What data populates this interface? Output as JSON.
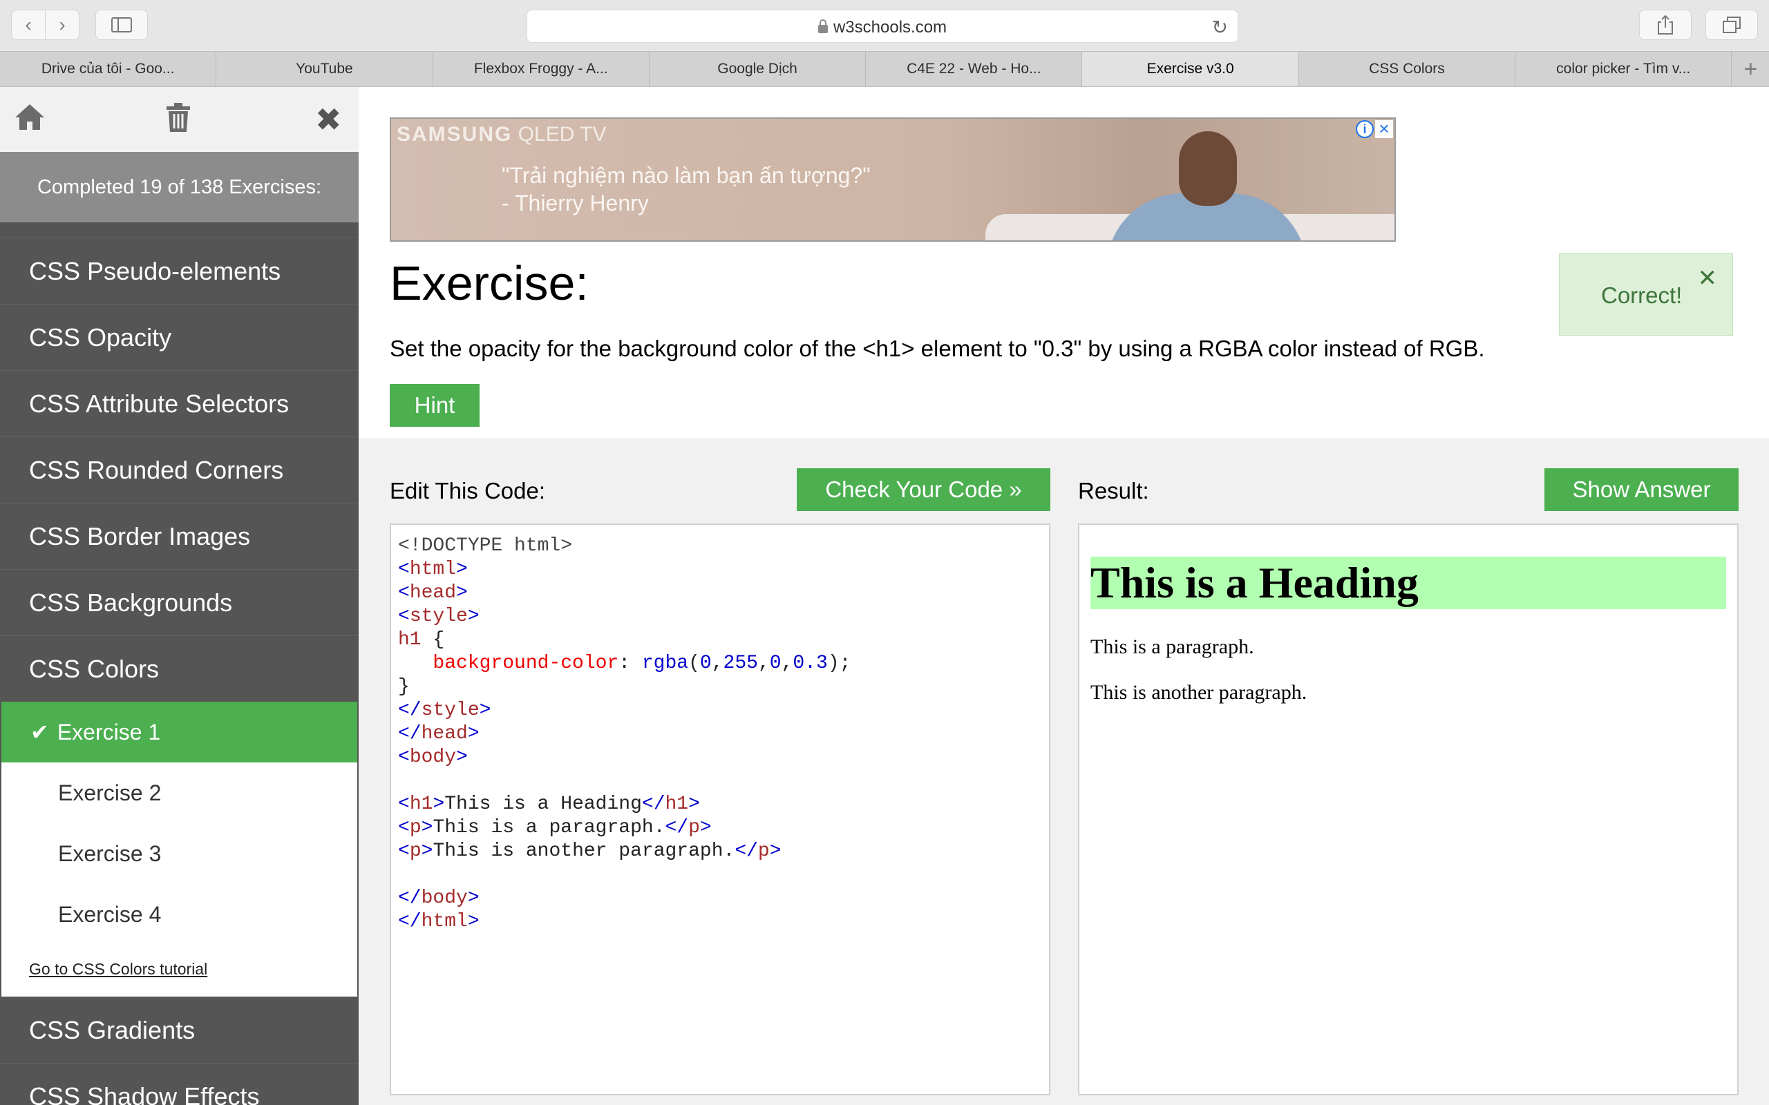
{
  "browser": {
    "address": "w3schools.com",
    "tabs": [
      {
        "label": "Drive của tôi - Goo...",
        "active": false
      },
      {
        "label": "YouTube",
        "active": false
      },
      {
        "label": "Flexbox Froggy - A...",
        "active": false
      },
      {
        "label": "Google Dịch",
        "active": false
      },
      {
        "label": "C4E 22 - Web - Ho...",
        "active": false
      },
      {
        "label": "Exercise v3.0",
        "active": true
      },
      {
        "label": "CSS Colors",
        "active": false
      },
      {
        "label": "color picker - Tìm v...",
        "active": false
      }
    ]
  },
  "sidebar": {
    "progress": "Completed 19 of 138 Exercises:",
    "sections_before": [
      "CSS Pseudo-elements",
      "CSS Opacity",
      "CSS Attribute Selectors",
      "CSS Rounded Corners",
      "CSS Border Images",
      "CSS Backgrounds",
      "CSS Colors"
    ],
    "exercises": [
      "Exercise 1",
      "Exercise 2",
      "Exercise 3",
      "Exercise 4"
    ],
    "active_exercise": "Exercise 1",
    "tutorial_link": "Go to CSS Colors tutorial",
    "sections_after": [
      "CSS Gradients",
      "CSS Shadow Effects"
    ]
  },
  "ad": {
    "brand_bold": "SAMSUNG",
    "brand_rest": " QLED TV",
    "quote_line1": "\"Trải nghiệm nào làm bạn ấn tượng?\"",
    "quote_line2": "- Thierry Henry"
  },
  "exercise": {
    "title": "Exercise:",
    "instructions": "Set the opacity for the background color of the <h1> element to \"0.3\" by using a RGBA color instead of RGB.",
    "hint_label": "Hint",
    "correct_text": "Correct!",
    "close_glyph": "✕"
  },
  "editor": {
    "edit_label": "Edit This Code:",
    "check_button": "Check Your Code »",
    "result_label": "Result:",
    "show_answer_button": "Show Answer",
    "code_lines": [
      [
        {
          "t": "doctype",
          "s": "<!DOCTYPE html>"
        }
      ],
      [
        {
          "t": "bracket",
          "s": "<"
        },
        {
          "t": "tag",
          "s": "html"
        },
        {
          "t": "bracket",
          "s": ">"
        }
      ],
      [
        {
          "t": "bracket",
          "s": "<"
        },
        {
          "t": "tag",
          "s": "head"
        },
        {
          "t": "bracket",
          "s": ">"
        }
      ],
      [
        {
          "t": "bracket",
          "s": "<"
        },
        {
          "t": "tag",
          "s": "style"
        },
        {
          "t": "bracket",
          "s": ">"
        }
      ],
      [
        {
          "t": "tag",
          "s": "h1"
        },
        {
          "t": "plain",
          "s": " {"
        }
      ],
      [
        {
          "t": "plain",
          "s": "   "
        },
        {
          "t": "prop",
          "s": "background-color"
        },
        {
          "t": "plain",
          "s": ": "
        },
        {
          "t": "val",
          "s": "rgba"
        },
        {
          "t": "plain",
          "s": "("
        },
        {
          "t": "val",
          "s": "0"
        },
        {
          "t": "plain",
          "s": ","
        },
        {
          "t": "val",
          "s": "255"
        },
        {
          "t": "plain",
          "s": ","
        },
        {
          "t": "val",
          "s": "0"
        },
        {
          "t": "plain",
          "s": ","
        },
        {
          "t": "val",
          "s": "0.3"
        },
        {
          "t": "plain",
          "s": ");"
        }
      ],
      [
        {
          "t": "plain",
          "s": "}"
        }
      ],
      [
        {
          "t": "bracket",
          "s": "</"
        },
        {
          "t": "tag",
          "s": "style"
        },
        {
          "t": "bracket",
          "s": ">"
        }
      ],
      [
        {
          "t": "bracket",
          "s": "</"
        },
        {
          "t": "tag",
          "s": "head"
        },
        {
          "t": "bracket",
          "s": ">"
        }
      ],
      [
        {
          "t": "bracket",
          "s": "<"
        },
        {
          "t": "tag",
          "s": "body"
        },
        {
          "t": "bracket",
          "s": ">"
        }
      ],
      [],
      [
        {
          "t": "bracket",
          "s": "<"
        },
        {
          "t": "tag",
          "s": "h1"
        },
        {
          "t": "bracket",
          "s": ">"
        },
        {
          "t": "plain",
          "s": "This is a Heading"
        },
        {
          "t": "bracket",
          "s": "</"
        },
        {
          "t": "tag",
          "s": "h1"
        },
        {
          "t": "bracket",
          "s": ">"
        }
      ],
      [
        {
          "t": "bracket",
          "s": "<"
        },
        {
          "t": "tag",
          "s": "p"
        },
        {
          "t": "bracket",
          "s": ">"
        },
        {
          "t": "plain",
          "s": "This is a paragraph."
        },
        {
          "t": "bracket",
          "s": "</"
        },
        {
          "t": "tag",
          "s": "p"
        },
        {
          "t": "bracket",
          "s": ">"
        }
      ],
      [
        {
          "t": "bracket",
          "s": "<"
        },
        {
          "t": "tag",
          "s": "p"
        },
        {
          "t": "bracket",
          "s": ">"
        },
        {
          "t": "plain",
          "s": "This is another paragraph."
        },
        {
          "t": "bracket",
          "s": "</"
        },
        {
          "t": "tag",
          "s": "p"
        },
        {
          "t": "bracket",
          "s": ">"
        }
      ],
      [],
      [
        {
          "t": "bracket",
          "s": "</"
        },
        {
          "t": "tag",
          "s": "body"
        },
        {
          "t": "bracket",
          "s": ">"
        }
      ],
      [
        {
          "t": "bracket",
          "s": "</"
        },
        {
          "t": "tag",
          "s": "html"
        },
        {
          "t": "bracket",
          "s": ">"
        }
      ]
    ]
  },
  "result": {
    "heading": "This is a Heading",
    "paragraph1": "This is a paragraph.",
    "paragraph2": "This is another paragraph.",
    "heading_bg": "rgba(0,255,0,0.3)"
  },
  "icons": {
    "back": "chevron-left-icon",
    "forward": "chevron-right-icon",
    "sidebar": "sidebar-icon",
    "lock": "lock-icon",
    "reload": "reload-icon",
    "share": "share-icon",
    "tabs": "tabs-overview-icon",
    "home": "home-icon",
    "trash": "trash-icon",
    "close": "close-icon",
    "check": "checkmark-icon"
  },
  "colors": {
    "accent_green": "#4caf50",
    "sidebar_bg": "#555555",
    "correct_bg": "#dff0d8",
    "correct_text": "#3c763d"
  }
}
